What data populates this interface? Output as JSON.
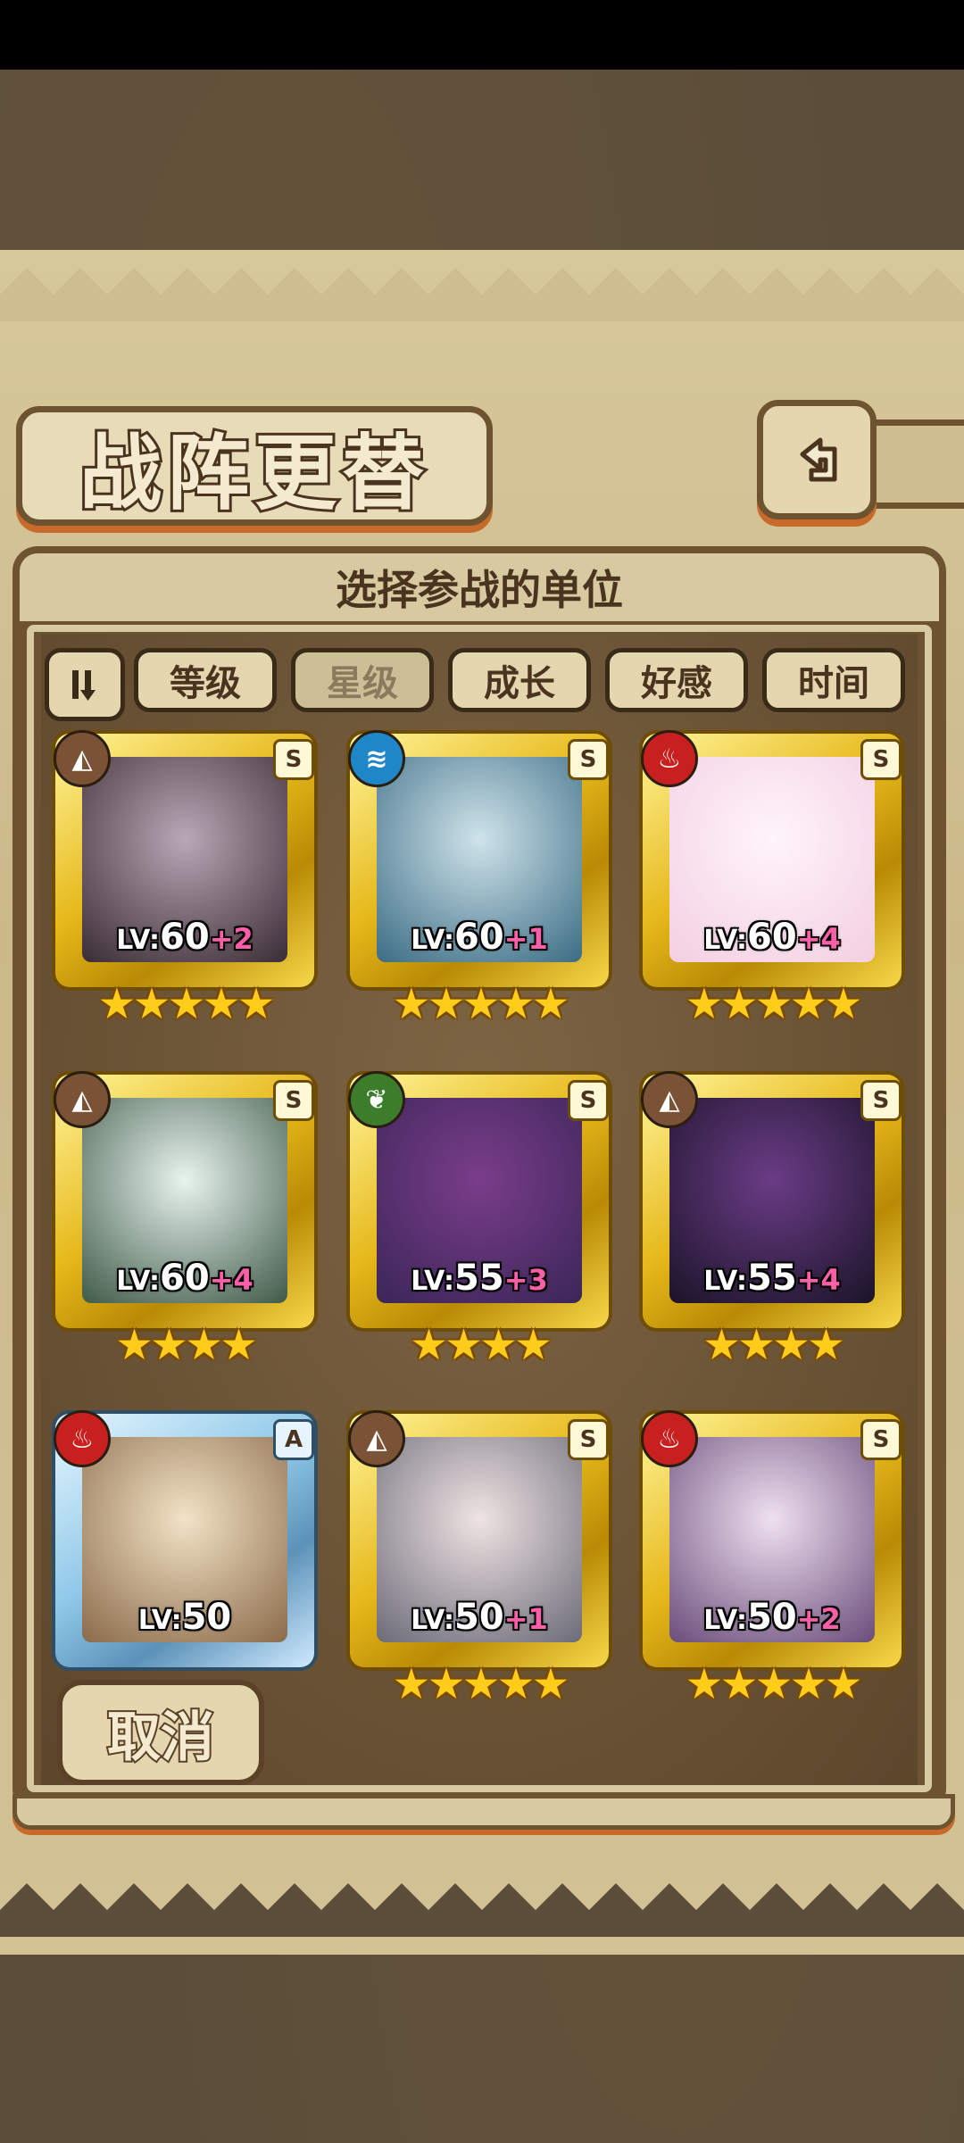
{
  "page": {
    "title": "战阵更替",
    "subtitle": "选择参战的单位"
  },
  "sort": {
    "toggle_icon": "sort-order-icon",
    "options": [
      {
        "label": "等级",
        "active": false
      },
      {
        "label": "星级",
        "active": true
      },
      {
        "label": "成长",
        "active": false
      },
      {
        "label": "好感",
        "active": false
      },
      {
        "label": "时间",
        "active": false
      }
    ]
  },
  "units": [
    {
      "level_prefix": "LV:",
      "level": "60",
      "bonus": "+2",
      "stars": "★★★★★",
      "rank": "S",
      "element": "earth",
      "element_glyph": "◭",
      "element_color": "#7a5236",
      "frame": "gold"
    },
    {
      "level_prefix": "LV:",
      "level": "60",
      "bonus": "+1",
      "stars": "★★★★★",
      "rank": "S",
      "element": "water",
      "element_glyph": "≋",
      "element_color": "#1f86c7",
      "frame": "gold"
    },
    {
      "level_prefix": "LV:",
      "level": "60",
      "bonus": "+4",
      "stars": "★★★★★",
      "rank": "S",
      "element": "fire",
      "element_glyph": "♨",
      "element_color": "#c8201e",
      "frame": "gold"
    },
    {
      "level_prefix": "LV:",
      "level": "60",
      "bonus": "+4",
      "stars": "★★★★",
      "rank": "S",
      "element": "earth",
      "element_glyph": "◭",
      "element_color": "#7a5236",
      "frame": "gold"
    },
    {
      "level_prefix": "LV:",
      "level": "55",
      "bonus": "+3",
      "stars": "★★★★",
      "rank": "S",
      "element": "wind",
      "element_glyph": "❦",
      "element_color": "#3b7d2a",
      "frame": "gold"
    },
    {
      "level_prefix": "LV:",
      "level": "55",
      "bonus": "+4",
      "stars": "★★★★",
      "rank": "S",
      "element": "earth",
      "element_glyph": "◭",
      "element_color": "#7a5236",
      "frame": "gold"
    },
    {
      "level_prefix": "LV:",
      "level": "50",
      "bonus": "",
      "stars": "",
      "rank": "A",
      "element": "fire",
      "element_glyph": "♨",
      "element_color": "#c8201e",
      "frame": "blue"
    },
    {
      "level_prefix": "LV:",
      "level": "50",
      "bonus": "+1",
      "stars": "★★★★★",
      "rank": "S",
      "element": "earth",
      "element_glyph": "◭",
      "element_color": "#7a5236",
      "frame": "gold"
    },
    {
      "level_prefix": "LV:",
      "level": "50",
      "bonus": "+2",
      "stars": "★★★★★",
      "rank": "S",
      "element": "fire",
      "element_glyph": "♨",
      "element_color": "#c8201e",
      "frame": "gold"
    }
  ],
  "cancel_label": "取消",
  "colors": {
    "panel_border": "#6e5330",
    "accent_orange": "#c86b2a",
    "gold_frame": "#e6b81a",
    "bonus_pink": "#ff5fa8"
  }
}
